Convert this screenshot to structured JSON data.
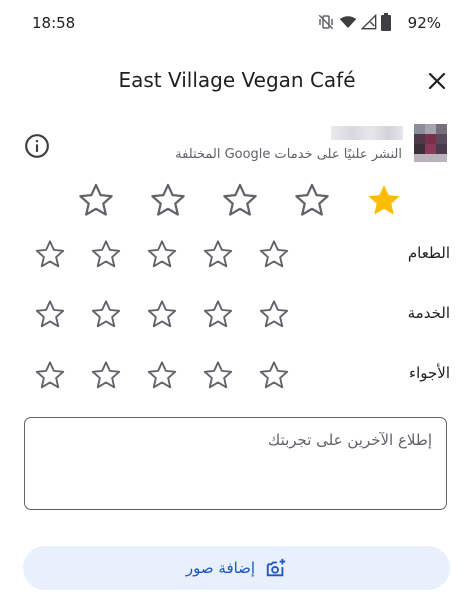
{
  "status_bar": {
    "time": "18:58",
    "battery": "92%",
    "icons": [
      "vibrate-off-icon",
      "wifi-icon",
      "signal-icon",
      "battery-icon"
    ]
  },
  "header": {
    "title": "East Village Vegan Café",
    "close_icon": "close-icon",
    "info_icon": "info-icon"
  },
  "user": {
    "posting_note": "النشر علنيًا على خدمات Google المختلفة"
  },
  "overall_rating": {
    "value": 1,
    "max": 5
  },
  "sub_ratings": [
    {
      "label": "الطعام",
      "value": 0,
      "max": 5
    },
    {
      "label": "الخدمة",
      "value": 0,
      "max": 5
    },
    {
      "label": "الأجواء",
      "value": 0,
      "max": 5
    }
  ],
  "review": {
    "placeholder": "إطلاع الآخرين على تجربتك",
    "value": ""
  },
  "add_photos": {
    "label": "إضافة صور",
    "icon": "add-photo-icon"
  },
  "colors": {
    "star_filled": "#fbbc04",
    "star_outline": "#5f6368",
    "accent": "#1a56c4",
    "button_bg": "#e8f0fe"
  }
}
